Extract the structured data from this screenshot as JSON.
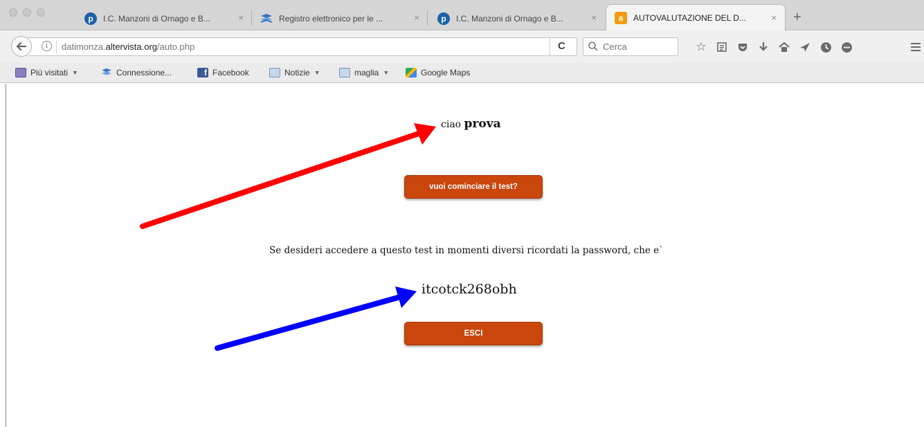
{
  "tabs": [
    {
      "title": "I.C. Manzoni di Ornago e B...",
      "favicon": "p-circle-icon",
      "color": "#1d62a8"
    },
    {
      "title": "Registro elettronico per le ...",
      "favicon": "registro-icon",
      "color": "#3a73c4"
    },
    {
      "title": "I.C. Manzoni di Ornago e B...",
      "favicon": "p-circle-icon",
      "color": "#1d62a8"
    },
    {
      "title": "AUTOVALUTAZIONE DEL D...",
      "favicon": "altervista-icon",
      "color": "#f39c12",
      "active": true
    }
  ],
  "tab_close_glyph": "×",
  "tab_new_glyph": "+",
  "favicon_letters": {
    "p": "p",
    "a": "a"
  },
  "address": {
    "prefix": "datimonza.",
    "domain": "altervista.org",
    "path": "/auto.php"
  },
  "search": {
    "placeholder": "Cerca"
  },
  "bookmarks": [
    {
      "label": "Più visitati",
      "icon": "most-visited-icon",
      "dropdown": true
    },
    {
      "label": "Connessione...",
      "icon": "registro-icon",
      "dropdown": false
    },
    {
      "label": "Facebook",
      "icon": "facebook-icon",
      "dropdown": false
    },
    {
      "label": "Notizie",
      "icon": "folder-icon",
      "dropdown": true
    },
    {
      "label": "maglia",
      "icon": "folder-icon",
      "dropdown": true
    },
    {
      "label": "Google Maps",
      "icon": "google-maps-icon",
      "dropdown": false
    }
  ],
  "page": {
    "greeting": "ciao",
    "user": "prova",
    "start_button": "vuoi cominciare il test?",
    "message": "Se desideri accedere a questo test in momenti diversi ricordati la password, che e`",
    "password": "itcotck268obh",
    "exit_button": "ESCI"
  },
  "colors": {
    "button": "#c9460d",
    "arrow_red": "#ff0000",
    "arrow_blue": "#0000ff"
  }
}
